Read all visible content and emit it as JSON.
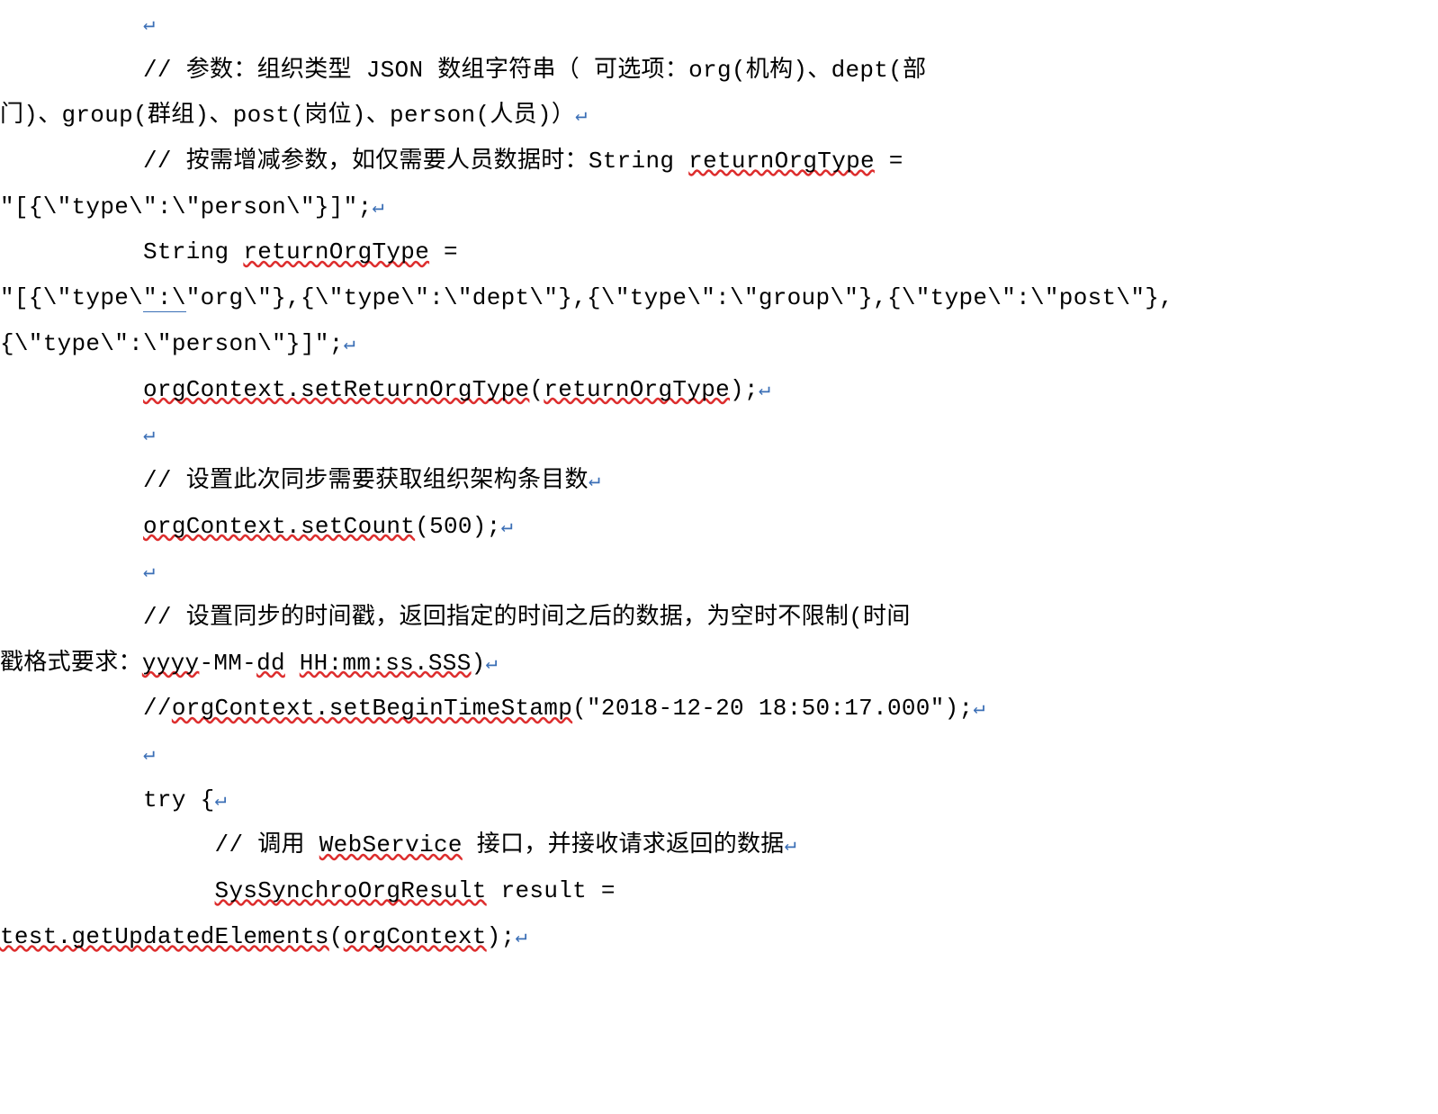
{
  "glyph": {
    "nl": "↵"
  },
  "lines": {
    "l1a": "          ",
    "l1b": "          // 参数：组织类型 JSON 数组字符串（ 可选项：org(机构)、dept(部",
    "l1c": "门)、group(群组)、post(岗位)、person(人员)）",
    "l2a_prefix": "          // 按需增减参数，如仅需要人员数据时：String ",
    "l2a_tok": "returnOrgType",
    "l2a_suffix": " = ",
    "l2b": "\"[{\\\"type\\\":\\\"person\\\"}]\";",
    "l3a_prefix": "          String ",
    "l3a_tok": "returnOrgType",
    "l3a_suffix": " = ",
    "l3b_a": "\"[{\\\"type\\",
    "l3b_b": "\":\\",
    "l3b_c": "\"org\\\"},{\\\"type\\\":\\\"dept\\\"},{\\\"type\\\":\\\"group\\\"},{\\\"type\\\":\\\"post\\\"},",
    "l3c": "{\\\"type\\\":\\\"person\\\"}]\";",
    "l4_pre": "          ",
    "l4_t1": "orgContext.setReturnOrgType",
    "l4_mid": "(",
    "l4_t2": "returnOrgType",
    "l4_post": ");",
    "l5": "          ",
    "l6": "          // 设置此次同步需要获取组织架构条目数",
    "l7_pre": "          ",
    "l7_t1": "orgContext.setCount",
    "l7_post": "(500);",
    "l8": "          ",
    "l9a": "          // 设置同步的时间戳，返回指定的时间之后的数据，为空时不限制(时间",
    "l9b_pre": "戳格式要求：",
    "l9b_t1": "yyyy",
    "l9b_mid1": "-MM-",
    "l9b_t2": "dd",
    "l9b_sp": " ",
    "l9b_t3": "HH:mm:ss.SSS",
    "l9b_post": ")",
    "l10_pre": "          //",
    "l10_t1": "orgContext.setBeginTimeStamp",
    "l10_post": "(\"2018-12-20 18:50:17.000\");",
    "l11": "          ",
    "l12": "          try {",
    "l13_pre": "               // 调用 ",
    "l13_t1": "WebService",
    "l13_post": " 接口，并接收请求返回的数据",
    "l14_pre": "               ",
    "l14_t1": "SysSynchroOrgResult",
    "l14_post": " result = ",
    "l15_t1": "test.getUpdatedElements",
    "l15_mid": "(",
    "l15_t2": "orgContext",
    "l15_post": ");"
  }
}
